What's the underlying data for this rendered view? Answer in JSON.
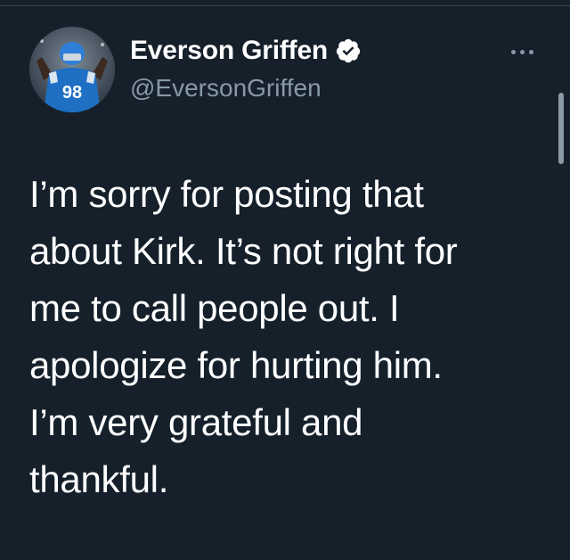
{
  "tweet": {
    "author": {
      "display_name": "Everson Griffen",
      "handle": "@EversonGriffen",
      "verified": true,
      "avatar": "avatar-football-player-blue-jersey"
    },
    "text_lines": [
      "I’m sorry for posting that",
      "about Kirk. It’s not right for",
      "me to call people out. I",
      "apologize for hurting him.",
      "I’m very grateful and",
      "thankful."
    ]
  },
  "icons": {
    "more": "more-horizontal-icon",
    "verified": "verified-badge-icon"
  },
  "colors": {
    "background": "#15202b",
    "secondary_text": "#8899a6",
    "divider": "#38444d",
    "jersey_blue": "#1f6fc4"
  }
}
